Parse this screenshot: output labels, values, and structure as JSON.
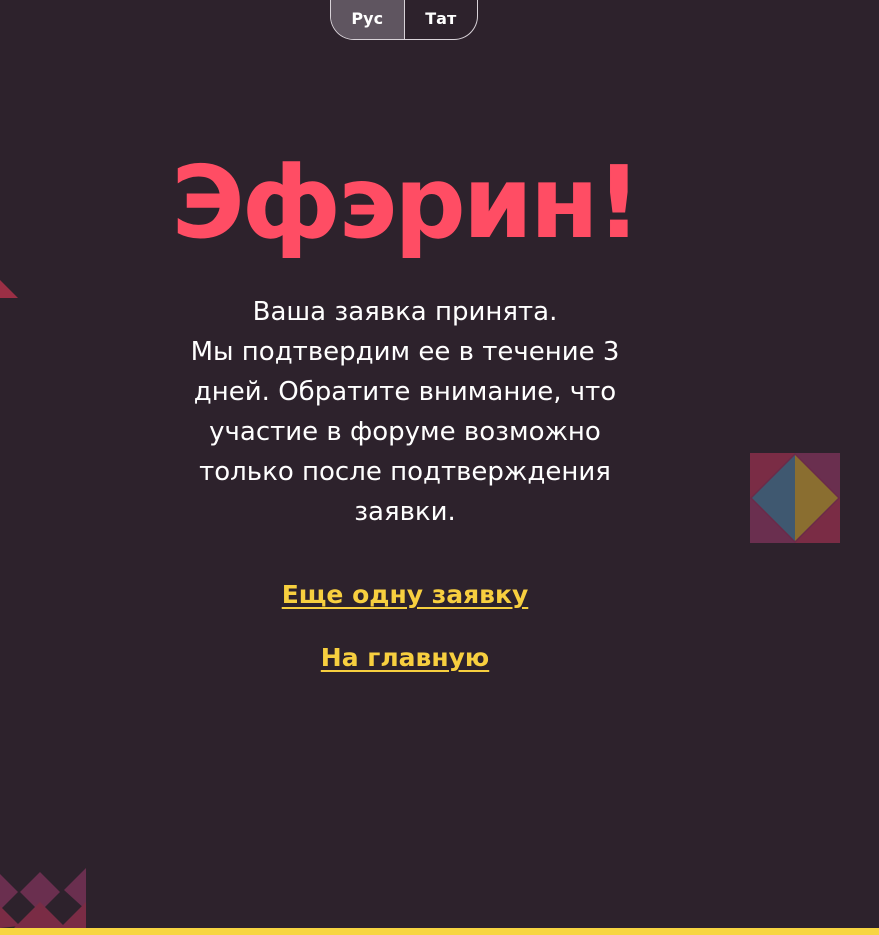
{
  "language_switch": {
    "options": [
      {
        "label": "Рус",
        "active": true
      },
      {
        "label": "Тат",
        "active": false
      }
    ]
  },
  "title": "Эфэрин!",
  "message": {
    "line1": "Ваша заявка принята.",
    "line2": "Мы подтвердим ее в течение 3 дней. Обратите внимание, что участие в форуме возможно только после подтверждения заявки."
  },
  "links": {
    "another_application": "Еще одну заявку",
    "home": "На главную"
  },
  "colors": {
    "background": "#2d222c",
    "accent_red": "#ff4d64",
    "link_yellow": "#f7cf3f",
    "bottom_bar": "#f7d542"
  }
}
